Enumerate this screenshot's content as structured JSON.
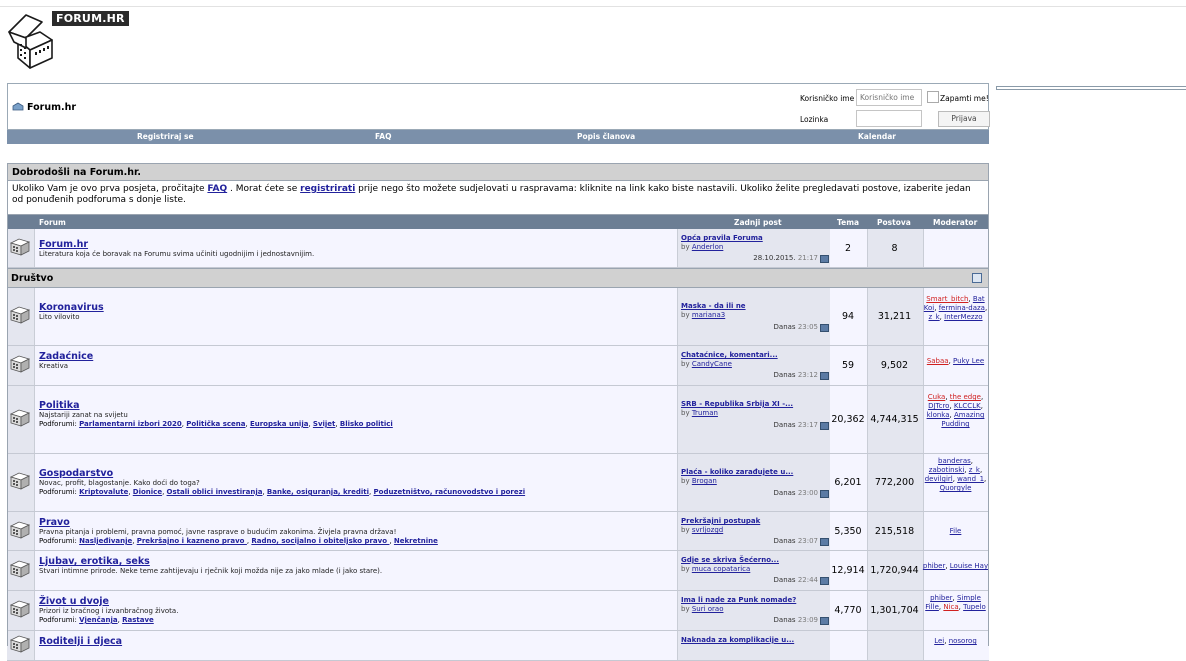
{
  "logo": {
    "badge_text": "FORUM.HR"
  },
  "navbar": {
    "breadcrumb": "Forum.hr",
    "username_label": "Korisničko ime",
    "username_placeholder": "Korisničko ime",
    "remember_label": "Zapamti me!",
    "password_label": "Lozinka",
    "login_button": "Prijava"
  },
  "menu": [
    "Registriraj se",
    "FAQ",
    "Popis članova",
    "Kalendar"
  ],
  "welcome": {
    "title": "Dobrodošli na Forum.hr.",
    "text_1": "Ukoliko Vam je ovo prva posjeta, pročitajte ",
    "link_faq": "FAQ",
    "text_2": " . Morat ćete se ",
    "link_register": "registrirati",
    "text_3": " prije nego što možete sudjelovati u raspravama: kliknite na link kako biste nastavili. Ukoliko želite pregledavati postove, izaberite jedan od ponuđenih podforuma s donje liste."
  },
  "table_header": {
    "forum": "Forum",
    "last_post": "Zadnji post",
    "threads": "Tema",
    "posts": "Postova",
    "moderator": "Moderator"
  },
  "category": "Društvo",
  "forums": [
    {
      "title": "Forum.hr",
      "desc": "Literatura koja će boravak na Forumu svima učiniti ugodnijim i jednostavnijim.",
      "subforums_label": "",
      "subforums": [],
      "last_title": "Opća pravila Foruma",
      "last_by": "by ",
      "last_user": "Anderlon",
      "last_date": "28.10.2015.",
      "last_time": "21:17",
      "threads": "2",
      "posts": "8",
      "mods": []
    },
    {
      "title": "Koronavirus",
      "desc": "Lito vilovito",
      "subforums_label": "",
      "subforums": [],
      "last_title": "Maska - da ili ne",
      "last_by": "by ",
      "last_user": "mariana3",
      "last_date": "Danas",
      "last_time": "23:05",
      "threads": "94",
      "posts": "31,211",
      "mods": [
        {
          "name": "Smart_bitch",
          "red": true
        },
        {
          "name": "Bat Koi",
          "red": false
        },
        {
          "name": "fermina-daza",
          "red": false
        },
        {
          "name": "z_k",
          "red": false
        },
        {
          "name": "InterMezzo",
          "red": false
        }
      ]
    },
    {
      "title": "Zadaćnice",
      "desc": "Kreativa",
      "subforums_label": "",
      "subforums": [],
      "last_title": "Chataćnice, komentari...",
      "last_by": "by ",
      "last_user": "CandyCane",
      "last_date": "Danas",
      "last_time": "23:12",
      "threads": "59",
      "posts": "9,502",
      "mods": [
        {
          "name": "Sabaa",
          "red": true
        },
        {
          "name": "Puky Lee",
          "red": false
        }
      ]
    },
    {
      "title": "Politika",
      "desc": "Najstariji zanat na svijetu",
      "subforums_label": "Podforumi: ",
      "subforums": [
        "Parlamentarni izbori 2020",
        "Politička scena",
        "Europska unija",
        "Svijet",
        "Blisko politici"
      ],
      "last_title": "SRB - Republika Srbija XI -...",
      "last_by": "by ",
      "last_user": "Truman",
      "last_date": "Danas",
      "last_time": "23:17",
      "threads": "20,362",
      "posts": "4,744,315",
      "mods": [
        {
          "name": "Cuka",
          "red": true
        },
        {
          "name": "the edge",
          "red": true
        },
        {
          "name": "DJTcro",
          "red": false
        },
        {
          "name": "KLCCLK",
          "red": false
        },
        {
          "name": "klonka",
          "red": false
        },
        {
          "name": "Amazing Pudding",
          "red": false
        }
      ]
    },
    {
      "title": "Gospodarstvo",
      "desc": "Novac, profit, blagostanje. Kako doći do toga?",
      "subforums_label": "Podforumi: ",
      "subforums": [
        "Kriptovalute",
        "Dionice",
        "Ostali oblici investiranja",
        "Banke, osiguranja, krediti",
        "Poduzetništvo, računovodstvo i porezi"
      ],
      "last_title": "Plaća - koliko zarađujete u...",
      "last_by": "by ",
      "last_user": "Brogan",
      "last_date": "Danas",
      "last_time": "23:00",
      "threads": "6,201",
      "posts": "772,200",
      "mods": [
        {
          "name": "banderas",
          "red": false
        },
        {
          "name": "zabotinski",
          "red": false
        },
        {
          "name": "z_k",
          "red": false
        },
        {
          "name": "devilgirl",
          "red": false
        },
        {
          "name": "wand_1",
          "red": false
        },
        {
          "name": "Quorgyle",
          "red": false
        }
      ]
    },
    {
      "title": "Pravo",
      "desc": "Pravna pitanja i problemi, pravna pomoć, javne rasprave o budućim zakonima. Živjela pravna država!",
      "subforums_label": "Podforumi: ",
      "subforums": [
        "Nasljeđivanje",
        "Prekršajno i kazneno pravo ",
        "Radno, socijalno i obiteljsko pravo ",
        "Nekretnine"
      ],
      "last_title": "Prekršajni postupak",
      "last_by": "by ",
      "last_user": "svrljozgd",
      "last_date": "Danas",
      "last_time": "23:07",
      "threads": "5,350",
      "posts": "215,518",
      "mods": [
        {
          "name": "File",
          "red": false
        }
      ]
    },
    {
      "title": "Ljubav, erotika, seks",
      "desc": "Stvari intimne prirode. Neke teme zahtijevaju i rječnik koji možda nije za jako mlade (i jako stare).",
      "subforums_label": "",
      "subforums": [],
      "last_title": "Gdje se skriva Šećerno...",
      "last_by": "by ",
      "last_user": "muca copatarica",
      "last_date": "Danas",
      "last_time": "22:44",
      "threads": "12,914",
      "posts": "1,720,944",
      "mods": [
        {
          "name": "phiber",
          "red": false
        },
        {
          "name": "Louise Hay",
          "red": false
        }
      ]
    },
    {
      "title": "Život u dvoje",
      "desc": "Prizori iz bračnog i izvanbračnog života.",
      "subforums_label": "Podforumi: ",
      "subforums": [
        "Vjenčanja",
        "Rastave"
      ],
      "last_title": "Ima li nade za Punk nomade?",
      "last_by": "by ",
      "last_user": "Suri orao",
      "last_date": "Danas",
      "last_time": "23:09",
      "threads": "4,770",
      "posts": "1,301,704",
      "mods": [
        {
          "name": "phiber",
          "red": false
        },
        {
          "name": "Simple Fille",
          "red": false
        },
        {
          "name": "Nica",
          "red": true
        },
        {
          "name": "Tupelo",
          "red": false
        }
      ]
    },
    {
      "title": "Roditelji i djeca",
      "desc": "",
      "subforums_label": "",
      "subforums": [],
      "last_title": "Naknada za komplikacije u...",
      "last_by": "",
      "last_user": "",
      "last_date": "",
      "last_time": "",
      "threads": "",
      "posts": "",
      "mods": [
        {
          "name": "Lei",
          "red": false
        },
        {
          "name": "nosorog",
          "red": false
        }
      ]
    }
  ]
}
